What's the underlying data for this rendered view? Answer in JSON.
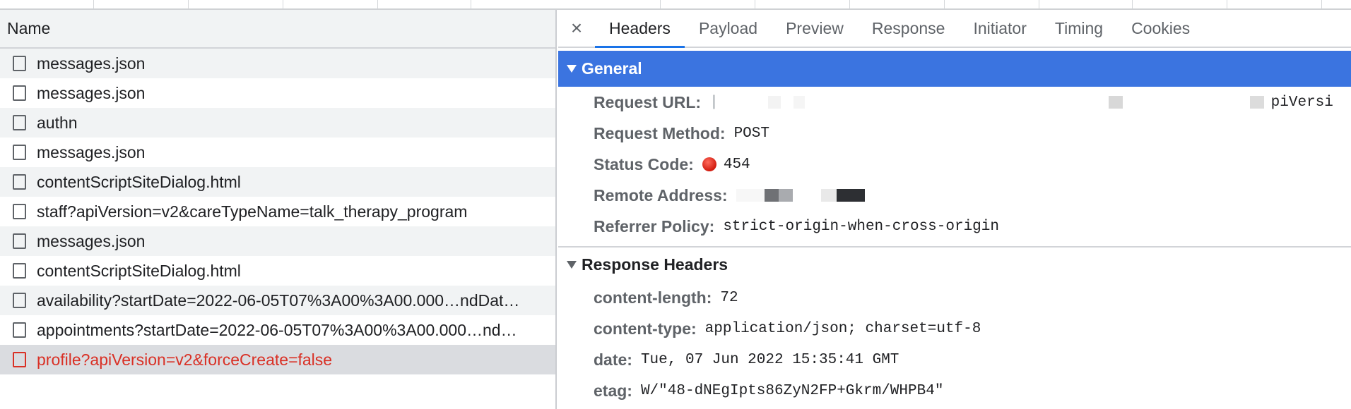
{
  "network_list": {
    "column_header": "Name",
    "rows": [
      {
        "name": "messages.json"
      },
      {
        "name": "messages.json"
      },
      {
        "name": "authn"
      },
      {
        "name": "messages.json"
      },
      {
        "name": "contentScriptSiteDialog.html"
      },
      {
        "name": "staff?apiVersion=v2&careTypeName=talk_therapy_program"
      },
      {
        "name": "messages.json"
      },
      {
        "name": "contentScriptSiteDialog.html"
      },
      {
        "name": "availability?startDate=2022-06-05T07%3A00%3A00.000…ndDat…"
      },
      {
        "name": "appointments?startDate=2022-06-05T07%3A00%3A00.000…nd…"
      },
      {
        "name": "profile?apiVersion=v2&forceCreate=false",
        "selected": true,
        "status": "error"
      }
    ]
  },
  "details": {
    "close_icon": "close-icon",
    "close_glyph": "×",
    "tabs": [
      {
        "label": "Headers",
        "active": true
      },
      {
        "label": "Payload"
      },
      {
        "label": "Preview"
      },
      {
        "label": "Response"
      },
      {
        "label": "Initiator"
      },
      {
        "label": "Timing"
      },
      {
        "label": "Cookies"
      }
    ],
    "general": {
      "title": "General",
      "request_url_label": "Request URL:",
      "request_url_prefix": "|",
      "request_url_suffix": "piVersi",
      "request_method_label": "Request Method:",
      "request_method": "POST",
      "status_code_label": "Status Code:",
      "status_code": "454",
      "remote_address_label": "Remote Address:",
      "referrer_policy_label": "Referrer Policy:",
      "referrer_policy": "strict-origin-when-cross-origin"
    },
    "response_headers": {
      "title": "Response Headers",
      "items": [
        {
          "key": "content-length:",
          "value": "72"
        },
        {
          "key": "content-type:",
          "value": "application/json; charset=utf-8"
        },
        {
          "key": "date:",
          "value": "Tue, 07 Jun 2022 15:35:41 GMT"
        },
        {
          "key": "etag:",
          "value": "W/\"48-dNEgIpts86ZyN2FP+Gkrm/WHPB4\""
        }
      ]
    }
  },
  "colors": {
    "accent": "#3b74e0",
    "tab_underline": "#1a73e8",
    "error": "#d93025",
    "status_dot": "#d11b0f"
  }
}
